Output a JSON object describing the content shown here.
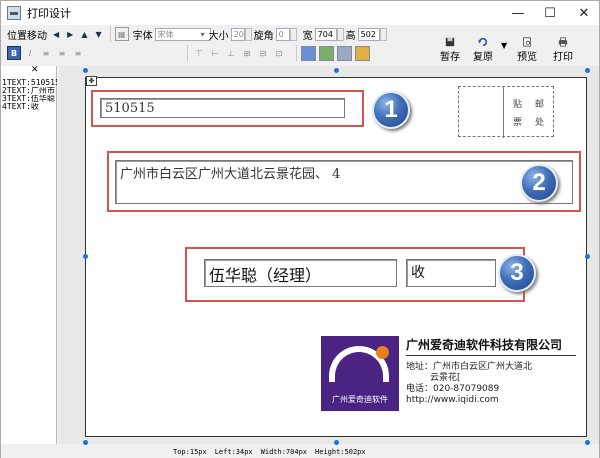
{
  "window": {
    "title": "打印设计",
    "minimize": "—",
    "maximize": "☐",
    "close": "✕"
  },
  "toolbar1": {
    "move_label": "位置移动",
    "font_label": "字体",
    "font_value": "宋体",
    "size_label": "大小",
    "size_value": "20",
    "rotate_label": "旋角",
    "rotate_value": "0",
    "width_label": "宽",
    "width_value": "704",
    "height_label": "高",
    "height_value": "502"
  },
  "toolbar_buttons": {
    "save": "暂存",
    "restore": "复原",
    "preview": "预览",
    "print": "打印"
  },
  "left_panel": {
    "close": "✕",
    "items": [
      "1TEXT:510515",
      "2TEXT:广州市",
      "3TEXT:伍华聪",
      "4TEXT:收"
    ]
  },
  "fields": {
    "postcode": "510515",
    "address": "广州市白云区广州大道北云景花园、                    4",
    "recipient": "伍华聪（经理）",
    "receive": "收"
  },
  "badges": [
    "1",
    "2",
    "3"
  ],
  "stamp": {
    "c1": "贴",
    "c2": "邮",
    "c3": "票",
    "c4": "处"
  },
  "logo": {
    "text": "广州爱奇迪软件"
  },
  "company": {
    "name": "广州爱奇迪软件科技有限公司",
    "addr1": "地址：广州市白云区广州大道北",
    "addr2": "云景花[",
    "phone": "电话：020-87079089",
    "web": "http://www.iqidi.com"
  },
  "status": {
    "top": "Top:15px",
    "left": "Left:34px",
    "width": "Width:704px",
    "height": "Height:502px"
  },
  "colors": {
    "highlight": "#d8534b",
    "badge": "#3e6fb8",
    "logo_bg": "#4b2483",
    "logo_accent": "#e8811a"
  }
}
